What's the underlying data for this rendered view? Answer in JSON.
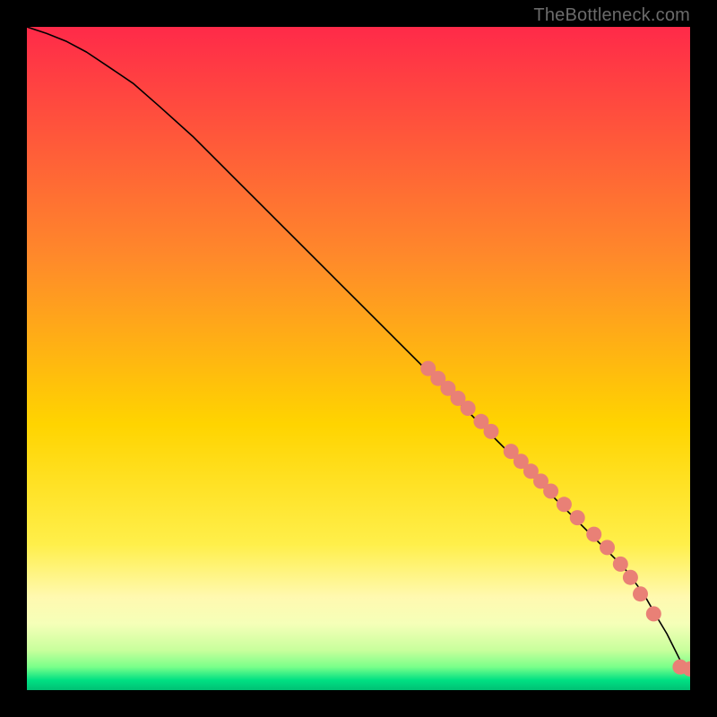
{
  "attribution": "TheBottleneck.com",
  "chart_data": {
    "type": "line",
    "title": "",
    "xlabel": "",
    "ylabel": "",
    "xlim": [
      0,
      100
    ],
    "ylim": [
      0,
      100
    ],
    "gradient_stops": [
      {
        "offset": 0.0,
        "color": "#ff2a49"
      },
      {
        "offset": 0.35,
        "color": "#ff8a2a"
      },
      {
        "offset": 0.6,
        "color": "#ffd400"
      },
      {
        "offset": 0.78,
        "color": "#ffef4a"
      },
      {
        "offset": 0.86,
        "color": "#fff9b0"
      },
      {
        "offset": 0.9,
        "color": "#f5ffb8"
      },
      {
        "offset": 0.94,
        "color": "#c8ff9c"
      },
      {
        "offset": 0.965,
        "color": "#7aff8a"
      },
      {
        "offset": 0.985,
        "color": "#00e083"
      },
      {
        "offset": 1.0,
        "color": "#00c074"
      }
    ],
    "series": [
      {
        "name": "bottleneck-curve",
        "color": "#000000",
        "stroke_width": 1.6,
        "x": [
          0,
          3,
          6,
          9,
          12,
          16,
          20,
          25,
          30,
          35,
          40,
          45,
          50,
          55,
          60,
          65,
          70,
          75,
          80,
          85,
          90,
          93,
          95,
          96.5,
          97.5,
          98.5,
          99.2,
          100
        ],
        "y": [
          100,
          99,
          97.8,
          96.2,
          94.2,
          91.5,
          88,
          83.5,
          78.5,
          73.5,
          68.5,
          63.5,
          58.5,
          53.5,
          48.5,
          43.5,
          38.5,
          33.5,
          28.5,
          23.5,
          18.5,
          14.5,
          11,
          8.5,
          6.5,
          4.5,
          3.5,
          3.2
        ]
      }
    ],
    "markers": {
      "name": "highlight-points",
      "color": "#e98076",
      "radius": 8.5,
      "points": [
        {
          "x": 60.5,
          "y": 48.5
        },
        {
          "x": 62.0,
          "y": 47.0
        },
        {
          "x": 63.5,
          "y": 45.5
        },
        {
          "x": 65.0,
          "y": 44.0
        },
        {
          "x": 66.5,
          "y": 42.5
        },
        {
          "x": 68.5,
          "y": 40.5
        },
        {
          "x": 70.0,
          "y": 39.0
        },
        {
          "x": 73.0,
          "y": 36.0
        },
        {
          "x": 74.5,
          "y": 34.5
        },
        {
          "x": 76.0,
          "y": 33.0
        },
        {
          "x": 77.5,
          "y": 31.5
        },
        {
          "x": 79.0,
          "y": 30.0
        },
        {
          "x": 81.0,
          "y": 28.0
        },
        {
          "x": 83.0,
          "y": 26.0
        },
        {
          "x": 85.5,
          "y": 23.5
        },
        {
          "x": 87.5,
          "y": 21.5
        },
        {
          "x": 89.5,
          "y": 19.0
        },
        {
          "x": 91.0,
          "y": 17.0
        },
        {
          "x": 92.5,
          "y": 14.5
        },
        {
          "x": 94.5,
          "y": 11.5
        },
        {
          "x": 98.5,
          "y": 3.5
        },
        {
          "x": 100.0,
          "y": 3.2
        }
      ]
    }
  }
}
